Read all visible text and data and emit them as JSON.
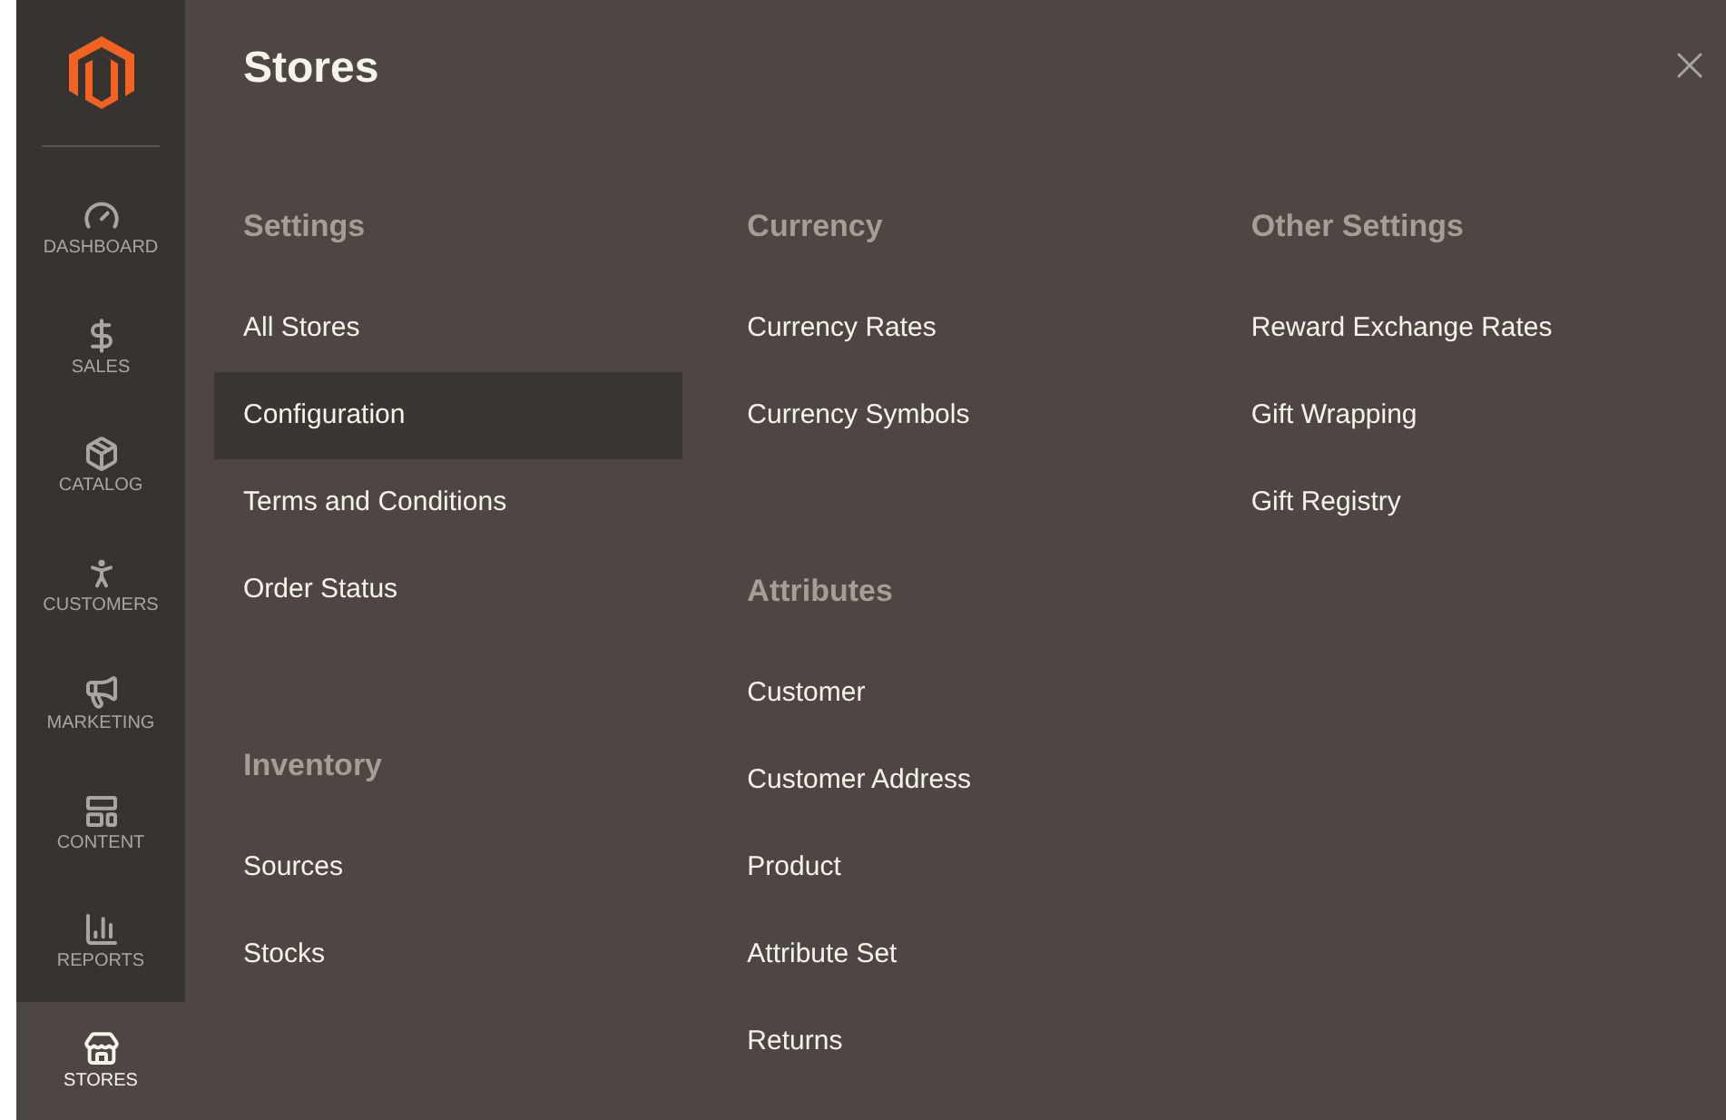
{
  "sidebar": {
    "items": [
      {
        "label": "DASHBOARD",
        "selected": false
      },
      {
        "label": "SALES",
        "selected": false
      },
      {
        "label": "CATALOG",
        "selected": false
      },
      {
        "label": "CUSTOMERS",
        "selected": false
      },
      {
        "label": "MARKETING",
        "selected": false
      },
      {
        "label": "CONTENT",
        "selected": false
      },
      {
        "label": "REPORTS",
        "selected": false
      },
      {
        "label": "STORES",
        "selected": true
      }
    ]
  },
  "panel": {
    "title": "Stores",
    "columns": [
      [
        {
          "title": "Settings",
          "items": [
            {
              "label": "All Stores",
              "selected": false
            },
            {
              "label": "Configuration",
              "selected": true
            },
            {
              "label": "Terms and Conditions",
              "selected": false
            },
            {
              "label": "Order Status",
              "selected": false
            }
          ]
        },
        {
          "title": "Inventory",
          "items": [
            {
              "label": "Sources",
              "selected": false
            },
            {
              "label": "Stocks",
              "selected": false
            }
          ]
        }
      ],
      [
        {
          "title": "Currency",
          "items": [
            {
              "label": "Currency Rates",
              "selected": false
            },
            {
              "label": "Currency Symbols",
              "selected": false
            }
          ]
        },
        {
          "title": "Attributes",
          "items": [
            {
              "label": "Customer",
              "selected": false
            },
            {
              "label": "Customer Address",
              "selected": false
            },
            {
              "label": "Product",
              "selected": false
            },
            {
              "label": "Attribute Set",
              "selected": false
            },
            {
              "label": "Returns",
              "selected": false
            }
          ]
        }
      ],
      [
        {
          "title": "Other Settings",
          "items": [
            {
              "label": "Reward Exchange Rates",
              "selected": false
            },
            {
              "label": "Gift Wrapping",
              "selected": false
            },
            {
              "label": "Gift Registry",
              "selected": false
            }
          ]
        }
      ]
    ]
  }
}
